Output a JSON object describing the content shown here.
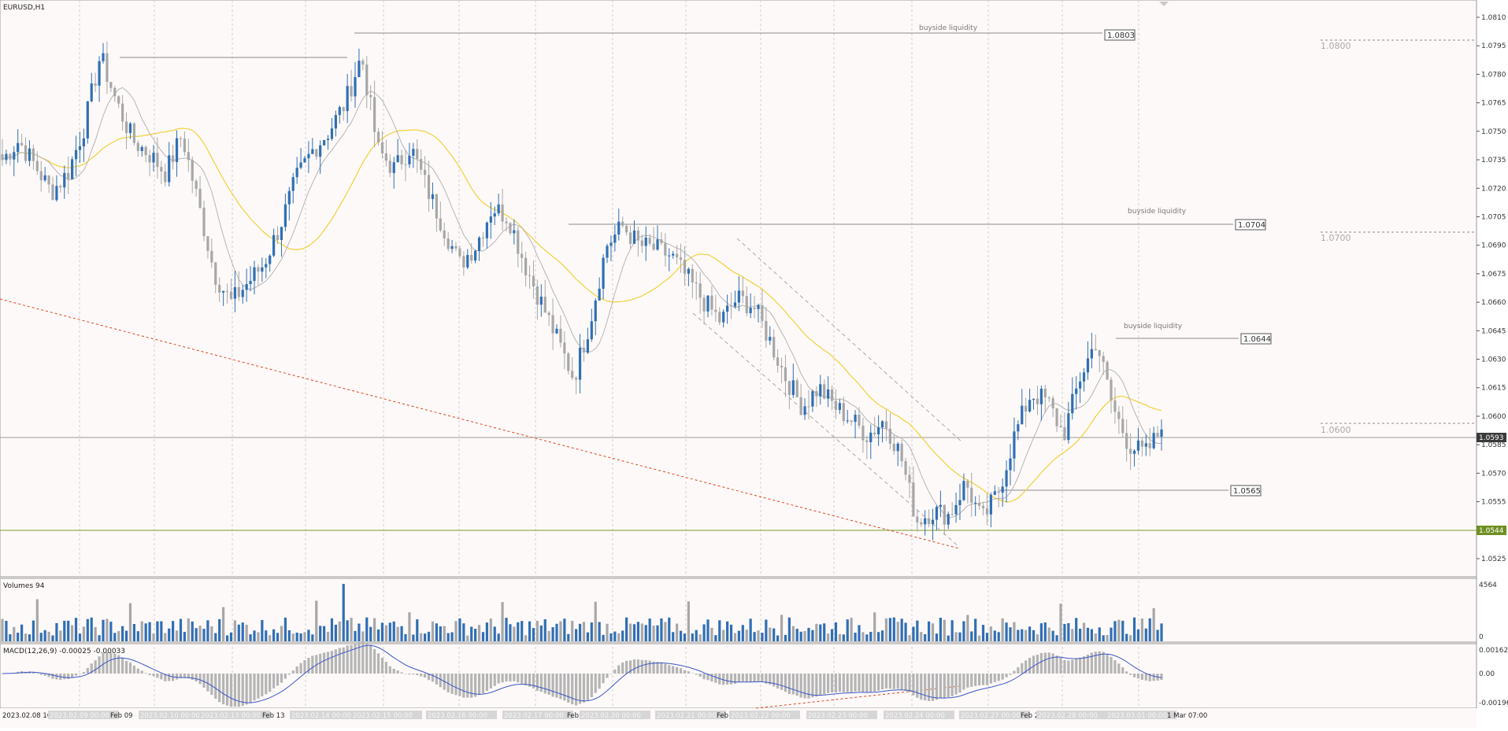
{
  "window": {
    "symbol_title": "EURUSD,H1",
    "volumes_title": "Volumes 94",
    "macd_title": "MACD(12,26,9) -0.00025 -0.00033"
  },
  "price_axis": {
    "ticks": [
      "1.0810",
      "1.0795",
      "1.0780",
      "1.0765",
      "1.0750",
      "1.0735",
      "1.0720",
      "1.0705",
      "1.0690",
      "1.0675",
      "1.0660",
      "1.0645",
      "1.0630",
      "1.0615",
      "1.0600",
      "1.0585",
      "1.0570",
      "1.0555",
      "1.0540",
      "1.0525"
    ],
    "current_price_label": "1.0593",
    "support_label": "1.0544"
  },
  "volume_axis": {
    "ticks": [
      "4564",
      "0"
    ]
  },
  "macd_axis": {
    "ticks": [
      "0.00162",
      "0.00",
      "-0.00196"
    ]
  },
  "time_axis": {
    "labels": [
      "2023.02.08 16:00",
      "2023.02.09 00:00",
      "Feb 09",
      "2023.02.10 00:00",
      "2023.02.13 00:00",
      "Feb 13",
      "2023.02.14 00:00",
      "2023.02.15 00:00",
      "2023.02.16 00:00",
      "2023.02.17 00:00",
      "Feb 17",
      "2023.02.20 00:00",
      "2023.02.21 00:00",
      "Feb 21",
      "2023.02.22 00:00",
      "2023.02.23 00:00",
      "2023.02.24 00:00",
      "2023.02.27 00:00",
      "Feb 27",
      "2023.02.28 00:00",
      "2023.03.01 00:00",
      "1 Mar 07:00"
    ]
  },
  "annotations": {
    "liquidity_text": "buyside liquidity",
    "levels": [
      "1.0803",
      "1.0704",
      "1.0644",
      "1.0565"
    ],
    "round_levels": [
      "1.0800",
      "1.0700",
      "1.0600"
    ]
  },
  "colors": {
    "background": "#fdf9f8",
    "bull_candle": "#2f6fb5",
    "bear_candle": "#a7a7a7",
    "ma_slow": "#f2d13a",
    "ma_fast": "#b5b5b5",
    "trendline": "#e0431f",
    "support_line": "#7a9a2a",
    "macd_signal": "#3d57c9",
    "macd_hist": "#b4b4b4"
  },
  "chart_data": {
    "type": "candlestick",
    "symbol": "EURUSD",
    "timeframe": "H1",
    "ylim": [
      1.052,
      1.0815
    ],
    "key_levels": {
      "buyside_liquidity": [
        1.0803,
        1.0704,
        1.0644
      ],
      "other": [
        1.0565
      ],
      "current_price": 1.0593,
      "support": 1.0544,
      "round_levels": [
        1.08,
        1.07,
        1.06
      ]
    },
    "close_path": [
      1.0735,
      1.0745,
      1.0732,
      1.0718,
      1.0728,
      1.0752,
      1.079,
      1.0765,
      1.0745,
      1.0738,
      1.0728,
      1.0748,
      1.0712,
      1.0675,
      1.066,
      1.067,
      1.068,
      1.07,
      1.0725,
      1.074,
      1.075,
      1.0765,
      1.079,
      1.074,
      1.073,
      1.0742,
      1.072,
      1.07,
      1.068,
      1.069,
      1.071,
      1.0705,
      1.068,
      1.066,
      1.064,
      1.062,
      1.065,
      1.069,
      1.07,
      1.069,
      1.0688,
      1.0684,
      1.0672,
      1.066,
      1.065,
      1.0662,
      1.0658,
      1.064,
      1.062,
      1.0605,
      1.0615,
      1.0605,
      1.0598,
      1.059,
      1.0598,
      1.058,
      1.0545,
      1.055,
      1.0548,
      1.0565,
      1.0545,
      1.056,
      1.059,
      1.0612,
      1.0608,
      1.059,
      1.062,
      1.064,
      1.0605,
      1.0585,
      1.058,
      1.0593
    ],
    "volume_max": 4564,
    "macd": {
      "fast": 12,
      "slow": 26,
      "signal": 9,
      "main": -0.00025,
      "signal_value": -0.00033,
      "ylim": [
        -0.00196,
        0.00162
      ]
    }
  }
}
